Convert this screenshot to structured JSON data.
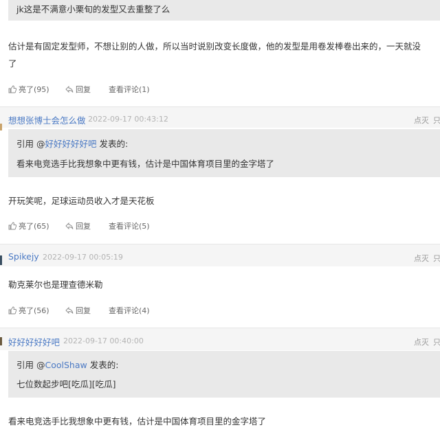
{
  "thread": {
    "top_quote_text": "jk这是不满意小栗旬的发型又去重整了么",
    "top_reply_line1": "估计是有固定发型师，不想让别的人做，所以当时说别改变长度做，他的发型是用卷发棒卷出来的，一天就没",
    "top_reply_line2": "了",
    "top_actions": {
      "like": "亮了(95)",
      "reply": "回复",
      "view": "查看评论(1)"
    }
  },
  "comments": [
    {
      "username": "想想张博士会怎么做",
      "time": "2022-09-17 00:43:12",
      "right_links": [
        "点灭",
        "只"
      ],
      "quote_prefix": "引用 @",
      "quote_user": "好好好好好吧",
      "quote_suffix": " 发表的:",
      "quote_text": "看来电竞选手比我想象中更有钱，估计是中国体育项目里的金字塔了",
      "body": "开玩笑呢，足球运动员收入才是天花板",
      "actions": {
        "like": "亮了(65)",
        "reply": "回复",
        "view": "查看评论(5)"
      }
    },
    {
      "username": "Spikejy",
      "time": "2022-09-17 00:05:19",
      "right_links": [
        "点灭",
        "只"
      ],
      "body": "勒克莱尔也是理查德米勒",
      "actions": {
        "like": "亮了(56)",
        "reply": "回复",
        "view": "查看评论(4)"
      }
    },
    {
      "username": "好好好好好吧",
      "time": "2022-09-17 00:40:00",
      "right_links": [
        "点灭",
        "只"
      ],
      "quote_prefix": "引用 @",
      "quote_user": "CoolShaw",
      "quote_suffix": " 发表的:",
      "quote_text": "七位数起步吧[吃瓜][吃瓜]",
      "body": "看来电竞选手比我想象中更有钱，估计是中国体育项目里的金字塔了"
    }
  ],
  "colors": {
    "link": "#4a79c4",
    "quote_bg": "#e9e9e9",
    "header_bg": "#f5f5f5",
    "timestamp": "#b3b3b3"
  }
}
